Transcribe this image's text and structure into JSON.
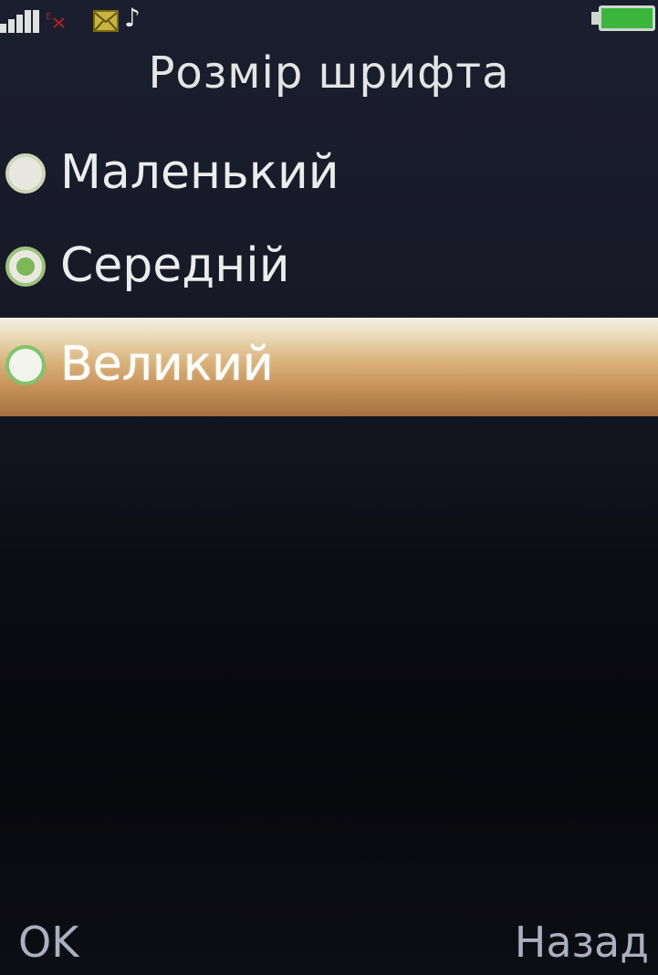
{
  "screen": {
    "title": "Розмір шрифта"
  },
  "status_bar": {
    "signal_icon": "signal-bars-icon",
    "data_icon": "no-data-icon",
    "message_icon": "envelope-icon",
    "music_icon": "music-note-icon",
    "battery_icon": "battery-icon",
    "battery_level": 1.0,
    "battery_color": "#3cb63c"
  },
  "options": [
    {
      "label": "Маленький",
      "selected": false,
      "highlighted": false
    },
    {
      "label": "Середній",
      "selected": true,
      "highlighted": false
    },
    {
      "label": "Великий",
      "selected": false,
      "highlighted": true
    }
  ],
  "softkeys": {
    "left": "OK",
    "right": "Назад"
  },
  "colors": {
    "highlight": "#d9b27a",
    "radio_selected": "#7cb858",
    "softkey_text": "#a9b0bf"
  }
}
